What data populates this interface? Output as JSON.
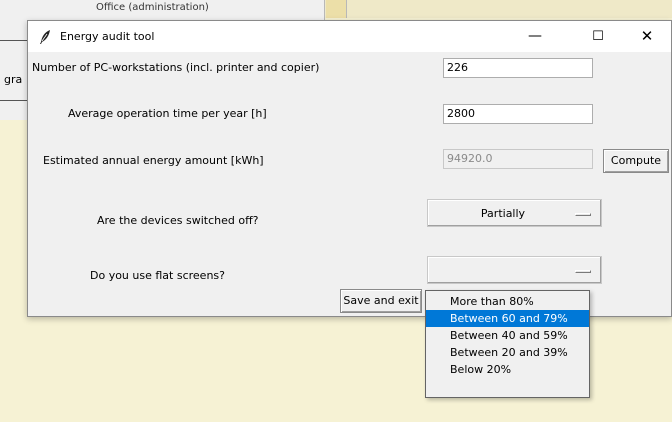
{
  "background": {
    "title_text": "Office (administration)",
    "side_text": "gra"
  },
  "window": {
    "title": "Energy audit tool",
    "controls": {
      "minimize": "—",
      "maximize": "☐",
      "close": "✕"
    }
  },
  "form": {
    "workstations": {
      "label": "Number of PC-workstations (incl. printer and copier)",
      "value": "226"
    },
    "operation_time": {
      "label": "Average operation time per year [h]",
      "value": "2800"
    },
    "energy": {
      "label": "Estimated annual energy amount [kWh]",
      "value": "94920.0",
      "button": "Compute"
    },
    "switched_off": {
      "label": "Are the devices switched off?",
      "selected": "Partially"
    },
    "flat_screens": {
      "label": "Do you use flat screens?",
      "selected": ""
    },
    "save_button": "Save and exit"
  },
  "dropdown": {
    "options": [
      "More than 80%",
      "Between 60 and 79%",
      "Between 40 and 59%",
      "Between 20 and 39%",
      "Below 20%"
    ],
    "highlighted": "Between 60 and 79%"
  },
  "colors": {
    "accent": "#0078d7",
    "background": "#f6f2d4",
    "window": "#f0f0f0"
  }
}
